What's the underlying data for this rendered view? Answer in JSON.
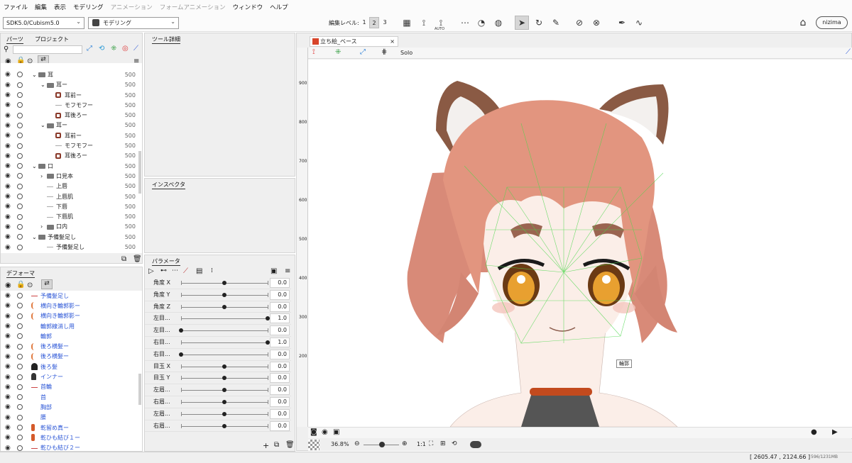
{
  "menu": [
    "ファイル",
    "編集",
    "表示",
    "モデリング",
    "アニメーション",
    "フォームアニメーション",
    "ウィンドウ",
    "ヘルプ"
  ],
  "toolbar": {
    "sdk": "SDK5.0/Cubism5.0",
    "mode": "モデリング",
    "edit_level_label": "編集レベル:",
    "levels": [
      "1",
      "2",
      "3"
    ],
    "auto_label": "AUTO",
    "nizima": "nizima"
  },
  "parts": {
    "tab1": "パーツ",
    "tab2": "プロジェクト",
    "rows": [
      {
        "ind": 0,
        "label": "",
        "num": ""
      },
      {
        "ind": 0,
        "label": "耳",
        "num": "500",
        "kind": "folder",
        "open": true
      },
      {
        "ind": 1,
        "label": "耳ー",
        "num": "500",
        "kind": "folder",
        "open": true
      },
      {
        "ind": 2,
        "label": "耳前ー",
        "num": "500",
        "kind": "art"
      },
      {
        "ind": 2,
        "label": "モフモフー",
        "num": "500",
        "kind": "line"
      },
      {
        "ind": 2,
        "label": "耳後ろー",
        "num": "500",
        "kind": "art"
      },
      {
        "ind": 1,
        "label": "耳ー",
        "num": "500",
        "kind": "folder",
        "open": true
      },
      {
        "ind": 2,
        "label": "耳前ー",
        "num": "500",
        "kind": "art"
      },
      {
        "ind": 2,
        "label": "モフモフー",
        "num": "500",
        "kind": "line"
      },
      {
        "ind": 2,
        "label": "耳後ろー",
        "num": "500",
        "kind": "art"
      },
      {
        "ind": 0,
        "label": "口",
        "num": "500",
        "kind": "folder",
        "open": true
      },
      {
        "ind": 1,
        "label": "口見本",
        "num": "500",
        "kind": "folder",
        "open": false
      },
      {
        "ind": 1,
        "label": "上唇",
        "num": "500",
        "kind": "line"
      },
      {
        "ind": 1,
        "label": "上唇肌",
        "num": "500",
        "kind": "line"
      },
      {
        "ind": 1,
        "label": "下唇",
        "num": "500",
        "kind": "line"
      },
      {
        "ind": 1,
        "label": "下唇肌",
        "num": "500",
        "kind": "line"
      },
      {
        "ind": 1,
        "label": "口内",
        "num": "500",
        "kind": "folder",
        "open": false
      },
      {
        "ind": 0,
        "label": "予備髪足し",
        "num": "500",
        "kind": "folder",
        "open": true
      },
      {
        "ind": 1,
        "label": "予備髪足し",
        "num": "500",
        "kind": "line"
      }
    ]
  },
  "deformer": {
    "tab": "デフォーマ",
    "rows": [
      {
        "label": "予備髪足し",
        "ic": "line"
      },
      {
        "label": "横向き輪郭影ー",
        "ic": "curve"
      },
      {
        "label": "横向き輪郭影ー",
        "ic": "curve"
      },
      {
        "label": "輪郭線消し用",
        "ic": "none"
      },
      {
        "label": "輪郭",
        "ic": "none"
      },
      {
        "label": "後ろ横髪ー",
        "ic": "curve"
      },
      {
        "label": "後ろ横髪ー",
        "ic": "curve"
      },
      {
        "label": "後ろ髪",
        "ic": "dark"
      },
      {
        "label": "インナー",
        "ic": "person"
      },
      {
        "label": "首輪",
        "ic": "line"
      },
      {
        "label": "首",
        "ic": "none"
      },
      {
        "label": "胸部",
        "ic": "none"
      },
      {
        "label": "腰",
        "ic": "none"
      },
      {
        "label": "乾留め真ー",
        "ic": "art"
      },
      {
        "label": "乾ひも結び１ー",
        "ic": "art"
      },
      {
        "label": "乾ひも結び２ー",
        "ic": "line"
      }
    ]
  },
  "tool_detail": {
    "title": "ツール詳細"
  },
  "inspector": {
    "title": "インスペクタ"
  },
  "params": {
    "title": "パラメータ",
    "rows": [
      {
        "name": "角度 X",
        "pos": 0.5,
        "val": "0.0"
      },
      {
        "name": "角度 Y",
        "pos": 0.5,
        "val": "0.0"
      },
      {
        "name": "角度 Z",
        "pos": 0.5,
        "val": "0.0"
      },
      {
        "name": "左目...",
        "pos": 1.0,
        "val": "1.0"
      },
      {
        "name": "左目...",
        "pos": 0.0,
        "val": "0.0"
      },
      {
        "name": "右目...",
        "pos": 1.0,
        "val": "1.0"
      },
      {
        "name": "右目...",
        "pos": 0.0,
        "val": "0.0"
      },
      {
        "name": "目玉 X",
        "pos": 0.5,
        "val": "0.0"
      },
      {
        "name": "目玉 Y",
        "pos": 0.5,
        "val": "0.0"
      },
      {
        "name": "左眉...",
        "pos": 0.5,
        "val": "0.0"
      },
      {
        "name": "右眉...",
        "pos": 0.5,
        "val": "0.0"
      },
      {
        "name": "左眉...",
        "pos": 0.5,
        "val": "0.0"
      },
      {
        "name": "右眉...",
        "pos": 0.5,
        "val": "0.0"
      }
    ]
  },
  "viewer": {
    "tab": "立ち絵_ベース",
    "solo": "Solo",
    "ruler": [
      "900",
      "800",
      "700",
      "600",
      "500",
      "400",
      "300",
      "200"
    ],
    "tooltip": "輪郭",
    "zoom": "36.8",
    "zoom_unit": "%",
    "ratio": "1:1"
  },
  "status": {
    "coords": "[ 2605.47 , 2124.66 ]",
    "memory": "596/1231MB"
  }
}
